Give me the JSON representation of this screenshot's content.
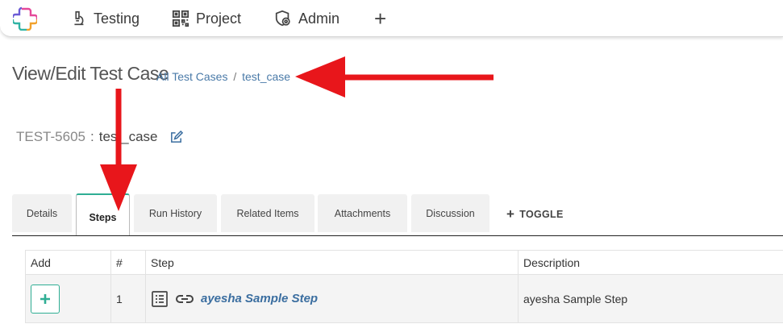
{
  "nav": {
    "items": [
      {
        "label": "Testing",
        "icon": "microscope-icon"
      },
      {
        "label": "Project",
        "icon": "qr-grid-icon"
      },
      {
        "label": "Admin",
        "icon": "shield-gear-icon"
      }
    ],
    "add_symbol": "+"
  },
  "header": {
    "title": "View/Edit Test Case",
    "breadcrumb": {
      "parent": "All Test Cases",
      "separator": "/",
      "current": "test_case"
    }
  },
  "test_case": {
    "id": "TEST-5605",
    "colon": ":",
    "name": "test_case"
  },
  "tabs": [
    {
      "label": "Details"
    },
    {
      "label": "Steps"
    },
    {
      "label": "Run History"
    },
    {
      "label": "Related Items"
    },
    {
      "label": "Attachments"
    },
    {
      "label": "Discussion"
    }
  ],
  "active_tab": "Steps",
  "toggle": {
    "label": "TOGGLE",
    "symbol": "+"
  },
  "table": {
    "headers": [
      "Add",
      "#",
      "Step",
      "Description"
    ],
    "rows": [
      {
        "number": "1",
        "step": "ayesha Sample Step",
        "description": "ayesha Sample Step"
      }
    ]
  },
  "colors": {
    "accent": "#2fae94",
    "link": "#3b6ea0",
    "arrow": "#e8161b"
  }
}
